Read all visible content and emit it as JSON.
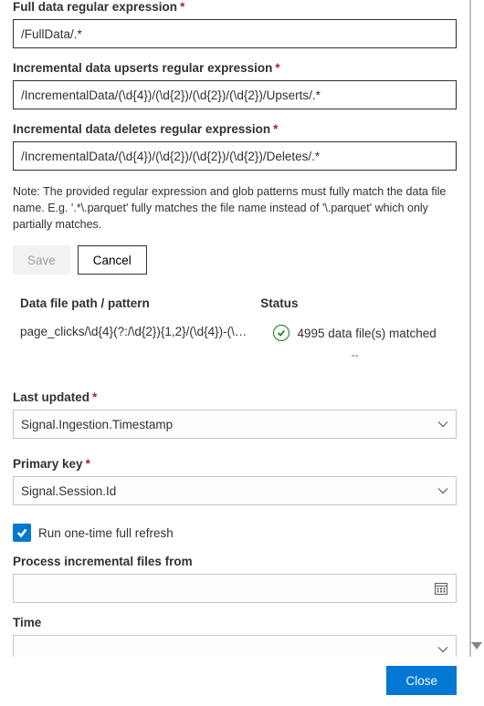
{
  "fields": {
    "full_regex": {
      "label": "Full data regular expression",
      "required": true,
      "value": "/FullData/.*"
    },
    "upserts_regex": {
      "label": "Incremental data upserts regular expression",
      "required": true,
      "value": "/IncrementalData/(\\d{4})/(\\d{2})/(\\d{2})/(\\d{2})/Upserts/.*"
    },
    "deletes_regex": {
      "label": "Incremental data deletes regular expression",
      "required": true,
      "value": "/IncrementalData/(\\d{4})/(\\d{2})/(\\d{2})/(\\d{2})/Deletes/.*"
    },
    "last_updated": {
      "label": "Last updated",
      "required": true,
      "value": "Signal.Ingestion.Timestamp"
    },
    "primary_key": {
      "label": "Primary key",
      "required": true,
      "value": "Signal.Session.Id"
    },
    "full_refresh": {
      "label": "Run one-time full refresh",
      "checked": true
    },
    "process_from": {
      "label": "Process incremental files from",
      "value": ""
    },
    "time": {
      "label": "Time",
      "value": ""
    }
  },
  "note": "Note: The provided regular expression and glob patterns must fully match the data file name. E.g. '.*\\.parquet' fully matches the file name instead of '\\.parquet' which only partially matches.",
  "buttons": {
    "save": "Save",
    "cancel": "Cancel",
    "close": "Close"
  },
  "table": {
    "headers": {
      "path": "Data file path / pattern",
      "status": "Status"
    },
    "rows": [
      {
        "path": "page_clicks/\\d{4}(?:/\\d{2}){1,2}/(\\d{4})-(\\…",
        "status_count": "4995 data file(s) matched",
        "status_extra": "--"
      }
    ]
  }
}
